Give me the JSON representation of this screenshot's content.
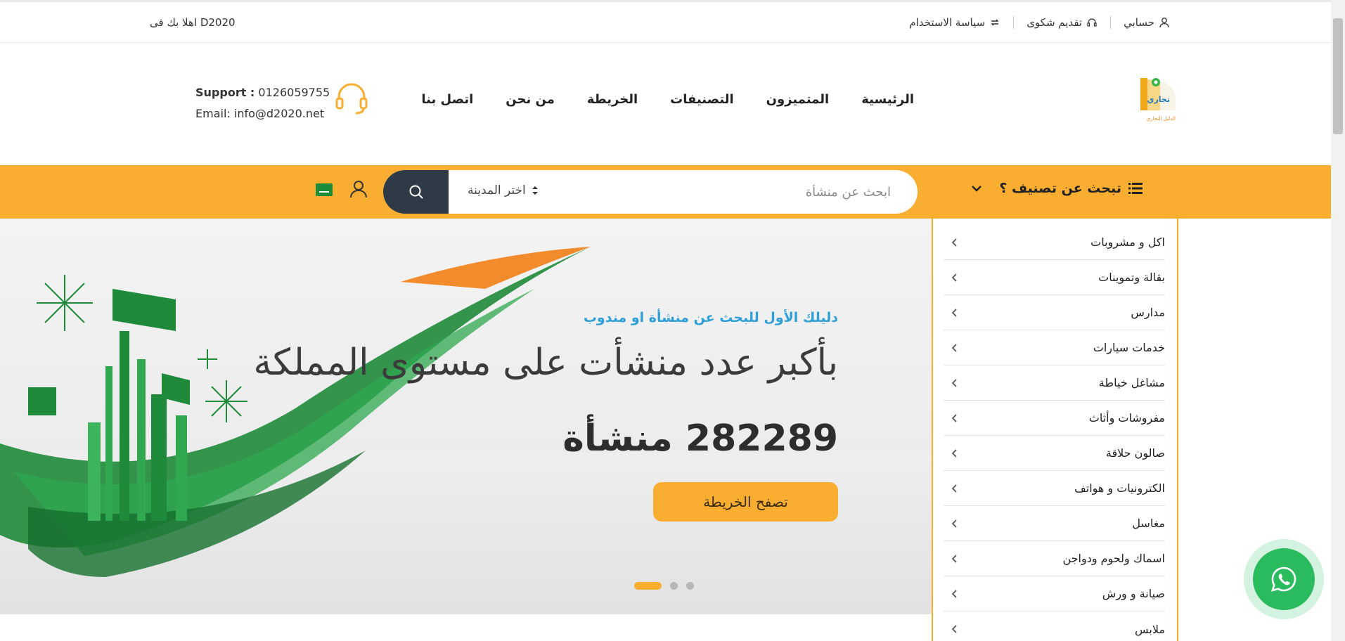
{
  "topbar": {
    "welcome": "اهلا بك فى D2020",
    "links": [
      {
        "label": "حسابي",
        "icon": "user-icon"
      },
      {
        "label": "تقديم شكوى",
        "icon": "headset-icon"
      },
      {
        "label": "سياسة الاستخدام",
        "icon": "refresh-icon"
      }
    ]
  },
  "header": {
    "logo_alt": "تجاري الدليل التجاري",
    "nav": [
      "الرئيسية",
      "المتميزون",
      "التصنيفات",
      "الخريطة",
      "من نحن",
      "اتصل بنا"
    ],
    "support_label": "Support :",
    "support_phone": "0126059755",
    "email": "Email: info@d2020.net"
  },
  "search": {
    "category_toggle": "تبحث عن تصنيف ؟",
    "placeholder": "ابحث عن منشأة",
    "city": "اختر المدينة"
  },
  "hero": {
    "tagline": "دليلك الأول للبحث عن منشأة او مندوب",
    "headline": "بأكبر عدد منشأت على مستوى المملكة",
    "count_line": "282289 منشأة",
    "cta": "تصفح الخريطة",
    "slides": 3,
    "active_slide": 1
  },
  "categories": [
    "اكل و مشروبات",
    "بقالة وتموينات",
    "مدارس",
    "خدمات سيارات",
    "مشاغل خياطة",
    "مفروشات وأثاث",
    "صالون حلاقة",
    "الكترونيات و هواتف",
    "مغاسل",
    "اسماك ولحوم ودواجن",
    "صيانة و ورش",
    "ملابس"
  ],
  "colors": {
    "accent": "#f9ae32",
    "dark": "#2e3a45",
    "tagline": "#2f9fd8",
    "whatsapp": "#2abb5e"
  }
}
